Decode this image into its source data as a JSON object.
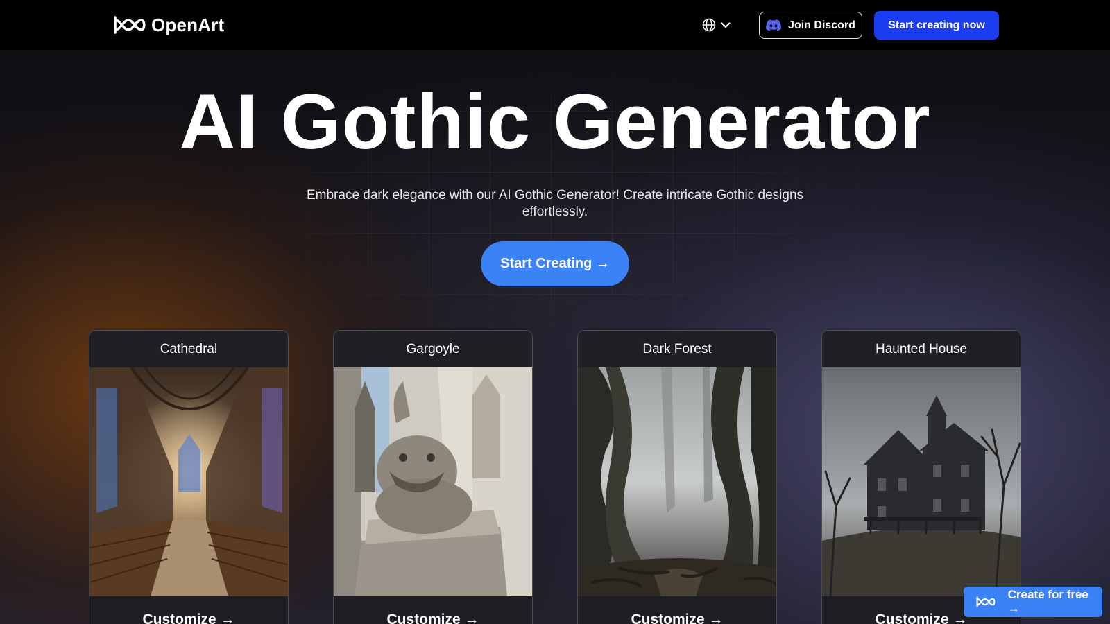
{
  "header": {
    "brand": "OpenArt",
    "language_icon": "globe-icon",
    "discord_label": "Join Discord",
    "start_now_label": "Start creating now"
  },
  "hero": {
    "title": "AI Gothic Generator",
    "subtitle": "Embrace dark elegance with our AI Gothic Generator! Create intricate Gothic designs effortlessly.",
    "cta_label": "Start Creating →"
  },
  "cards": [
    {
      "title": "Cathedral",
      "cta": "Customize →"
    },
    {
      "title": "Gargoyle",
      "cta": "Customize →"
    },
    {
      "title": "Dark Forest",
      "cta": "Customize →"
    },
    {
      "title": "Haunted House",
      "cta": "Customize →"
    }
  ],
  "float_cta": {
    "label": "Create for free →"
  },
  "colors": {
    "primary_blue": "#1a3cf0",
    "accent_blue": "#3b82f6",
    "header_bg": "#000000"
  }
}
